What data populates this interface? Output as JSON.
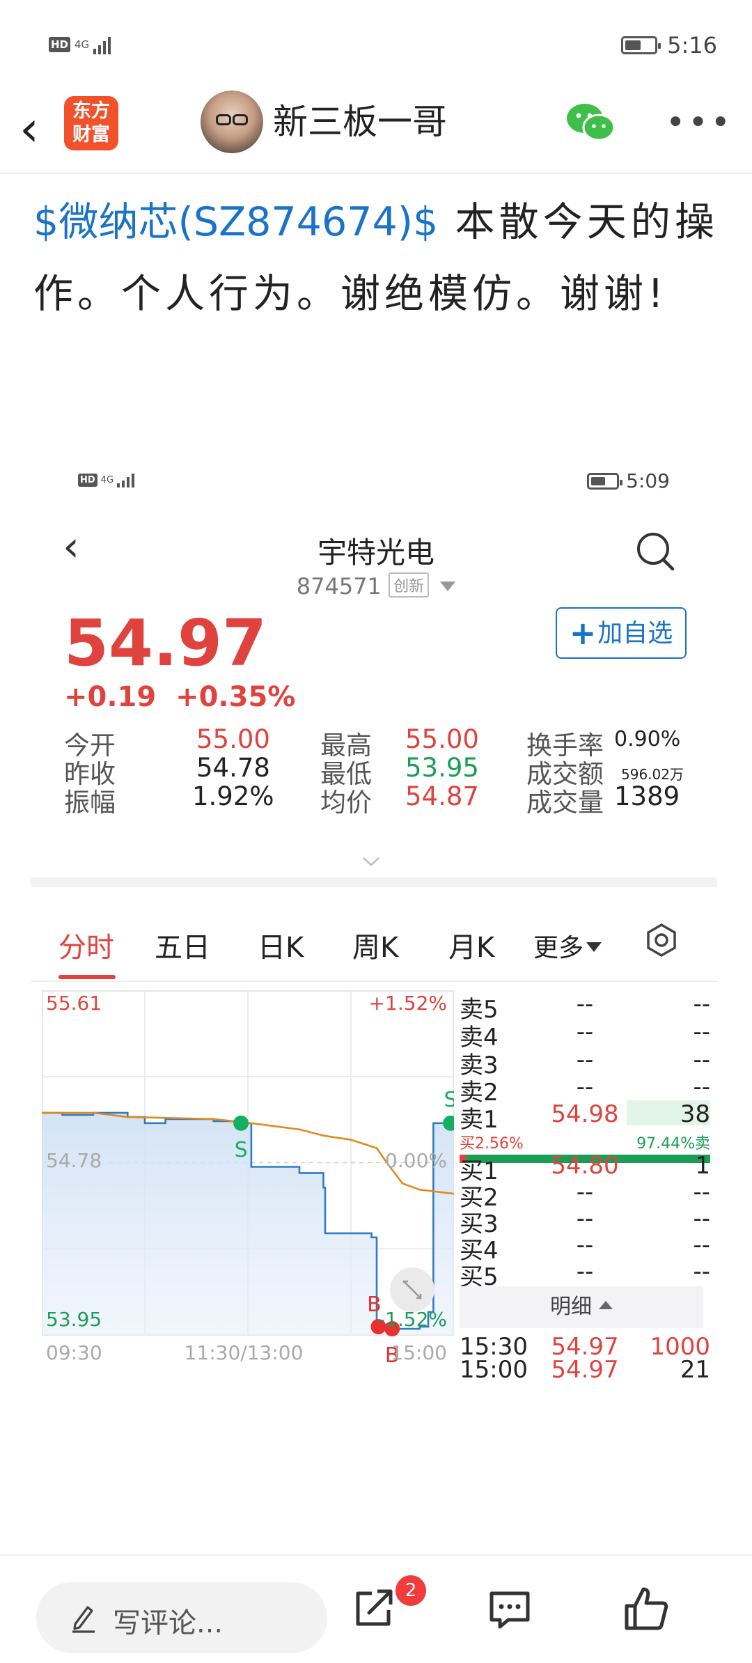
{
  "status_bar": {
    "network": "4G",
    "time": "5:16"
  },
  "nav": {
    "app_logo_line1": "东方",
    "app_logo_line2": "财富",
    "username": "新三板一哥"
  },
  "post": {
    "stock_tag": "$微纳芯(SZ874674)$",
    "text": " 本散今天的操作。个人行为。谢绝模仿。谢谢!"
  },
  "screenshot": {
    "status_bar": {
      "network": "4G",
      "time": "5:09"
    },
    "stock_name": "宇特光电",
    "stock_code": "874571",
    "board_badge": "创新",
    "price": "54.97",
    "change_abs": "+0.19",
    "change_pct": "+0.35%",
    "add_watchlist": "加自选",
    "stats": {
      "open_label": "今开",
      "open": "55.00",
      "prev_close_label": "昨收",
      "prev_close": "54.78",
      "amplitude_label": "振幅",
      "amplitude": "1.92%",
      "high_label": "最高",
      "high": "55.00",
      "low_label": "最低",
      "low": "53.95",
      "avg_label": "均价",
      "avg": "54.87",
      "turnover_rate_label": "换手率",
      "turnover_rate": "0.90%",
      "amount_label": "成交额",
      "amount": "596.02万",
      "volume_label": "成交量",
      "volume": "1389"
    },
    "tabs": [
      "分时",
      "五日",
      "日K",
      "周K",
      "月K",
      "更多"
    ],
    "active_tab": "分时",
    "order_book": {
      "sells": [
        {
          "label": "卖5",
          "price": "--",
          "vol": "--"
        },
        {
          "label": "卖4",
          "price": "--",
          "vol": "--"
        },
        {
          "label": "卖3",
          "price": "--",
          "vol": "--"
        },
        {
          "label": "卖2",
          "price": "--",
          "vol": "--"
        },
        {
          "label": "卖1",
          "price": "54.98",
          "vol": "38"
        }
      ],
      "ratio_buy": "买2.56%",
      "ratio_sell": "97.44%卖",
      "buys": [
        {
          "label": "买1",
          "price": "54.80",
          "vol": "1"
        },
        {
          "label": "买2",
          "price": "--",
          "vol": "--"
        },
        {
          "label": "买3",
          "price": "--",
          "vol": "--"
        },
        {
          "label": "买4",
          "price": "--",
          "vol": "--"
        },
        {
          "label": "买5",
          "price": "--",
          "vol": "--"
        }
      ],
      "detail_label": "明细",
      "trades": [
        {
          "time": "15:30",
          "price": "54.97",
          "vol": "1000"
        },
        {
          "time": "15:00",
          "price": "54.97",
          "vol": "21"
        }
      ]
    }
  },
  "chart_data": {
    "type": "line",
    "y_labels_left": [
      "55.61",
      "54.78",
      "53.95"
    ],
    "y_labels_right": [
      "+1.52%",
      "0.00%",
      "-1.52%"
    ],
    "x_labels": [
      "09:30",
      "11:30/13:00",
      "15:00"
    ],
    "ylim": [
      53.95,
      55.61
    ],
    "prev_close": 54.78,
    "x_range": [
      0,
      240
    ],
    "series": [
      {
        "color": "#2f7cc4",
        "points": [
          [
            0,
            55.02
          ],
          [
            12,
            55.02
          ],
          [
            12,
            55.01
          ],
          [
            30,
            55.01
          ],
          [
            30,
            55.02
          ],
          [
            50,
            55.02
          ],
          [
            50,
            55.0
          ],
          [
            60,
            55.0
          ],
          [
            60,
            54.97
          ],
          [
            72,
            54.97
          ],
          [
            72,
            54.99
          ],
          [
            100,
            54.99
          ],
          [
            100,
            54.98
          ],
          [
            115,
            54.98
          ],
          [
            115,
            54.97
          ],
          [
            122,
            54.97
          ],
          [
            122,
            54.76
          ],
          [
            150,
            54.76
          ],
          [
            150,
            54.73
          ],
          [
            164,
            54.73
          ],
          [
            164,
            54.66
          ],
          [
            165,
            54.66
          ],
          [
            165,
            54.44
          ],
          [
            192,
            54.44
          ],
          [
            192,
            54.42
          ],
          [
            195,
            54.42
          ],
          [
            195,
            54.0
          ],
          [
            200,
            54.0
          ],
          [
            200,
            53.98
          ],
          [
            220,
            53.98
          ],
          [
            220,
            53.99
          ],
          [
            225,
            53.99
          ],
          [
            225,
            54.06
          ],
          [
            228,
            54.06
          ],
          [
            228,
            54.97
          ],
          [
            240,
            54.97
          ]
        ]
      },
      {
        "color": "#e08a1e",
        "points": [
          [
            0,
            55.02
          ],
          [
            30,
            55.02
          ],
          [
            50,
            55.0
          ],
          [
            100,
            54.99
          ],
          [
            122,
            54.97
          ],
          [
            150,
            54.94
          ],
          [
            164,
            54.91
          ],
          [
            180,
            54.89
          ],
          [
            195,
            54.85
          ],
          [
            200,
            54.79
          ],
          [
            210,
            54.68
          ],
          [
            220,
            54.65
          ],
          [
            240,
            54.63
          ]
        ]
      }
    ],
    "trade_markers": [
      {
        "x": 116,
        "y": 54.97,
        "label": "S",
        "side": "sell"
      },
      {
        "x": 238,
        "y": 54.97,
        "label": "S",
        "side": "sell"
      },
      {
        "x": 196,
        "y": 53.99,
        "label": "B",
        "side": "buy"
      },
      {
        "x": 204,
        "y": 53.98,
        "label": "B",
        "side": "buy"
      }
    ]
  },
  "bottom_bar": {
    "comment_placeholder": "写评论...",
    "share_badge": "2"
  },
  "colors": {
    "up": "#e0433e",
    "down": "#1a9e55",
    "link": "#1a73c8",
    "brand": "#f2522b"
  }
}
